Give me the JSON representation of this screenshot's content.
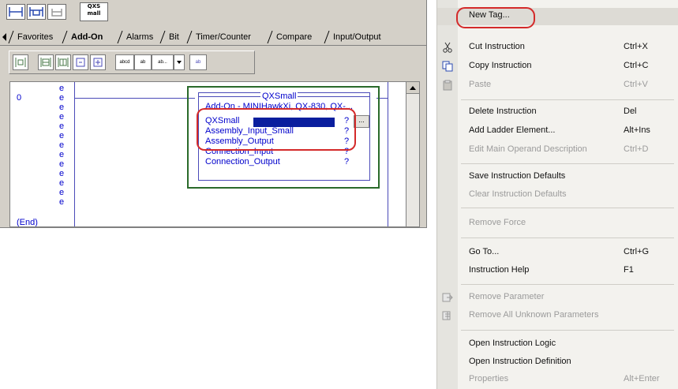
{
  "editor": {
    "qxs_button": [
      "QXS",
      "mall"
    ],
    "tabs": [
      "Favorites",
      "Add-On",
      "Alarms",
      "Bit",
      "Timer/Counter",
      "Compare",
      "Input/Output"
    ],
    "tool_labels": [
      "abcd",
      "ab",
      "ab...",
      "ab"
    ],
    "rung_number": "0",
    "e_marks": [
      "e",
      "e",
      "e",
      "e",
      "e",
      "e",
      "e",
      "e",
      "e",
      "e",
      "e",
      "e",
      "e"
    ],
    "end_label": "(End)",
    "aoi": {
      "name": "QXSmall",
      "description": "Add-On - MINIHawkXi, QX-830, QX-...",
      "params": [
        {
          "name": "QXSmall",
          "value": "?"
        },
        {
          "name": "Assembly_Input_Small",
          "value": "?"
        },
        {
          "name": "Assembly_Output",
          "value": "?"
        },
        {
          "name": "Connection_Input",
          "value": "?"
        },
        {
          "name": "Connection_Output",
          "value": "?"
        }
      ],
      "browse_label": "..."
    }
  },
  "context_menu": {
    "items": [
      {
        "label": "New Tag...",
        "accel": "",
        "enabled": true,
        "icon": ""
      },
      {
        "label": "Cut Instruction",
        "accel": "Ctrl+X",
        "enabled": true,
        "icon": "scissors-icon"
      },
      {
        "label": "Copy Instruction",
        "accel": "Ctrl+C",
        "enabled": true,
        "icon": "copy-icon"
      },
      {
        "label": "Paste",
        "accel": "Ctrl+V",
        "enabled": false,
        "icon": "paste-icon"
      },
      {
        "label": "Delete Instruction",
        "accel": "Del",
        "enabled": true,
        "icon": ""
      },
      {
        "label": "Add Ladder Element...",
        "accel": "Alt+Ins",
        "enabled": true,
        "icon": ""
      },
      {
        "label": "Edit Main Operand Description",
        "accel": "Ctrl+D",
        "enabled": false,
        "icon": ""
      },
      {
        "label": "Save Instruction Defaults",
        "accel": "",
        "enabled": true,
        "icon": ""
      },
      {
        "label": "Clear Instruction Defaults",
        "accel": "",
        "enabled": false,
        "icon": ""
      },
      {
        "label": "Remove Force",
        "accel": "",
        "enabled": false,
        "icon": ""
      },
      {
        "label": "Go To...",
        "accel": "Ctrl+G",
        "enabled": true,
        "icon": ""
      },
      {
        "label": "Instruction Help",
        "accel": "F1",
        "enabled": true,
        "icon": ""
      },
      {
        "label": "Remove Parameter",
        "accel": "",
        "enabled": false,
        "icon": "remove-parameter-icon"
      },
      {
        "label": "Remove All Unknown Parameters",
        "accel": "",
        "enabled": false,
        "icon": "remove-all-parameters-icon"
      },
      {
        "label": "Open Instruction Logic",
        "accel": "",
        "enabled": true,
        "icon": ""
      },
      {
        "label": "Open Instruction Definition",
        "accel": "",
        "enabled": true,
        "icon": ""
      },
      {
        "label": "Properties",
        "accel": "Alt+Enter",
        "enabled": false,
        "icon": ""
      }
    ]
  },
  "colors": {
    "highlight_red": "#d42a2a",
    "ladder_blue": "#0000cc",
    "aoi_border_green": "#2a6a2a",
    "selection_navy": "#0a1e9e"
  }
}
